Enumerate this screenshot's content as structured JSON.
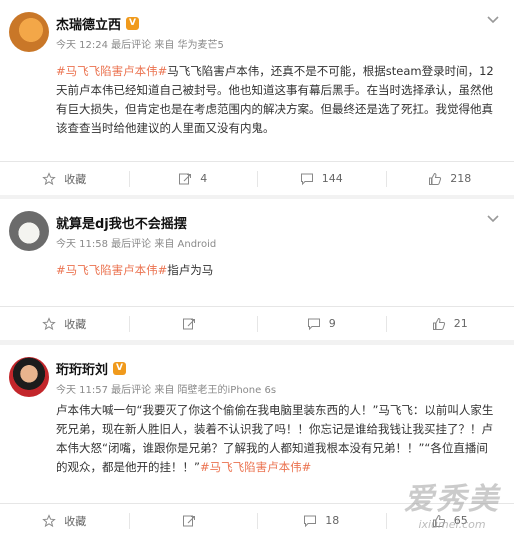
{
  "posts": [
    {
      "user": "杰瑞德立西",
      "badge": "vip",
      "meta": "今天 12:24 最后评论 来自 华为麦芒5",
      "content_tag": "#马飞飞陷害卢本伟#",
      "content_text": "马飞飞陷害卢本伟，还真不是不可能，根据steam登录时间，12天前卢本伟已经知道自己被封号。他也知道这事有幕后黑手。在当时选择承认，虽然他有巨大损失，但肯定也是在考虑范围内的解决方案。但最终还是选了死扛。我觉得他真该查查当时给他建议的人里面又没有内鬼。",
      "actions": {
        "collect": "收藏",
        "repost": "4",
        "comment": "144",
        "like": "218"
      }
    },
    {
      "user": "就算是dj我也不会摇摆",
      "meta": "今天 11:58 最后评论 来自 Android",
      "content_tag": "#马飞飞陷害卢本伟#",
      "content_text": "指卢为马",
      "actions": {
        "collect": "收藏",
        "repost": "",
        "comment": "9",
        "like": "21"
      }
    },
    {
      "user": "珩珩珩刘",
      "badge": "vip",
      "meta": "今天 11:57 最后评论 来自 陌壁老王的iPhone 6s",
      "content_text": "卢本伟大喊一句“我要灭了你这个偷偷在我电脑里装东西的人！”马飞飞：以前叫人家生死兄弟，现在新人胜旧人，装着不认识我了吗！！你忘记是谁给我钱让我买挂了？！卢本伟大怒“闭嘴，谁跟你是兄弟？了解我的人都知道我根本没有兄弟！！”“各位直播间的观众，都是他开的挂！！”",
      "content_tag": "#马飞飞陷害卢本伟#",
      "actions": {
        "collect": "收藏",
        "repost": "",
        "comment": "18",
        "like": "65"
      }
    }
  ],
  "watermark": {
    "cn": "爱秀美",
    "en": "ixiumei.com"
  },
  "icons": [
    "chevron-down-icon",
    "star-icon",
    "repost-icon",
    "comment-icon",
    "like-icon"
  ]
}
